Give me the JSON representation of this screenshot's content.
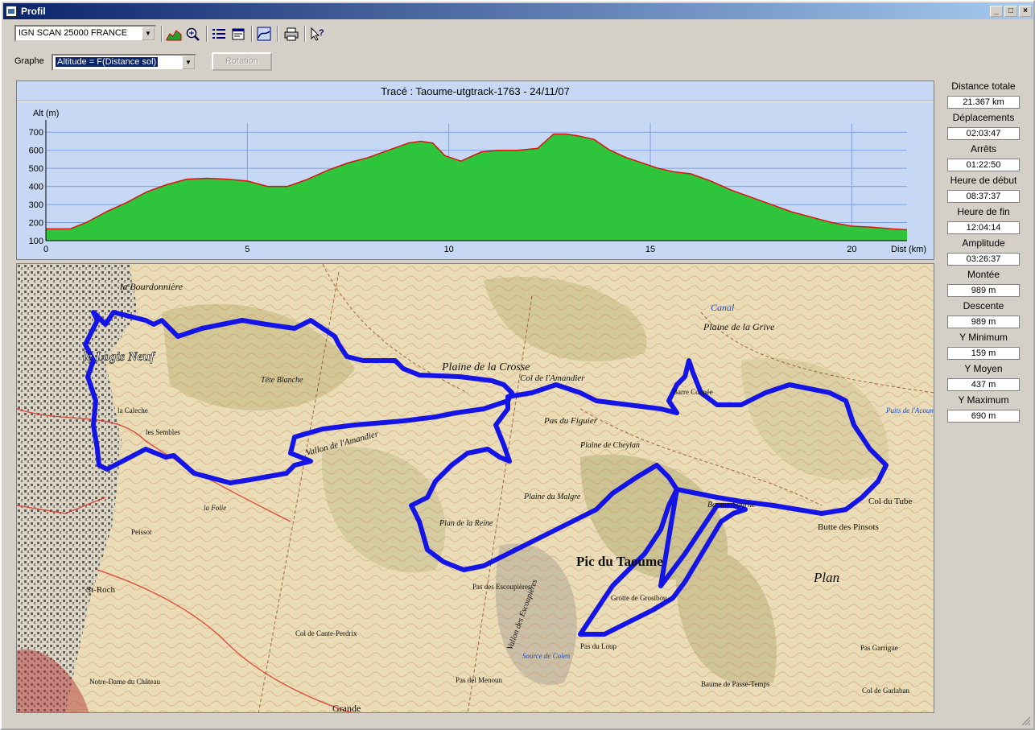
{
  "window": {
    "title": "Profil"
  },
  "titlebar_buttons": [
    "_",
    "□",
    "×"
  ],
  "toolbar": {
    "map_source": "IGN SCAN 25000 FRANCE",
    "icons": [
      "profile-icon",
      "zoom-icon",
      "list-icon",
      "properties-icon",
      "graph-icon",
      "print-icon",
      "help-pointer-icon"
    ]
  },
  "graph_row": {
    "label": "Graphe",
    "selected": "Altitude = F(Distance sol)",
    "rotation_button": "Rotation"
  },
  "chart_title": "Tracé : Taoume-utgtrack-1763 - 24/11/07",
  "chart_data": {
    "type": "area",
    "ylabel": "Alt (m)",
    "xlabel": "Dist (km)",
    "xlim": [
      0,
      21.37
    ],
    "ylim": [
      100,
      750
    ],
    "yticks": [
      100,
      200,
      300,
      400,
      500,
      600,
      700
    ],
    "xticks": [
      0,
      5,
      10,
      15,
      20
    ],
    "grid": true,
    "fill_color": "#2ec43c",
    "line_color": "#e01010",
    "background": "#c6d8f4",
    "x": [
      0,
      0.6,
      1,
      1.5,
      2,
      2.5,
      3,
      3.5,
      4,
      4.5,
      5,
      5.5,
      6,
      6.5,
      7,
      7.5,
      8,
      8.5,
      9,
      9.3,
      9.6,
      9.9,
      10.3,
      10.8,
      11.2,
      11.7,
      12.2,
      12.6,
      12.9,
      13.2,
      13.6,
      14,
      14.4,
      14.8,
      15.2,
      15.6,
      16,
      16.5,
      17,
      17.5,
      18,
      18.5,
      19,
      19.5,
      20,
      20.5,
      21,
      21.37
    ],
    "y": [
      165,
      165,
      200,
      260,
      310,
      370,
      410,
      440,
      445,
      440,
      430,
      400,
      400,
      440,
      490,
      530,
      560,
      600,
      640,
      650,
      640,
      570,
      540,
      590,
      600,
      600,
      610,
      690,
      690,
      680,
      660,
      600,
      560,
      530,
      500,
      480,
      470,
      430,
      380,
      340,
      300,
      260,
      230,
      200,
      180,
      175,
      165,
      160
    ]
  },
  "map": {
    "labels": [
      {
        "t": "la Bourdonnière"
      },
      {
        "t": "le Logis Neuf"
      },
      {
        "t": "Tête Blanche"
      },
      {
        "t": "Plaine de la Crosse"
      },
      {
        "t": "Col de l'Amandier"
      },
      {
        "t": "Pas du Figuier"
      },
      {
        "t": "Plaine de Cheylan"
      },
      {
        "t": "Vallon de l'Amandier"
      },
      {
        "t": "Plan de la Reine"
      },
      {
        "t": "Plaine du Malgre"
      },
      {
        "t": "Pic du Taoume"
      },
      {
        "t": "Baume-Sourne"
      },
      {
        "t": "Col du Tube"
      },
      {
        "t": "Butte des Pinsots"
      },
      {
        "t": "Plaine de la Grive"
      },
      {
        "t": "Canal"
      },
      {
        "t": "St-Roch"
      },
      {
        "t": "Col de Cante-Perdrix"
      },
      {
        "t": "Pas du Loup"
      },
      {
        "t": "Grotte de Grosibou"
      },
      {
        "t": "Plan"
      },
      {
        "t": "Col de Garlaban"
      },
      {
        "t": "Notre-Dame du Château"
      },
      {
        "t": "Grande"
      },
      {
        "t": "Pas des Escoupières"
      },
      {
        "t": "Vallon des Escoupières"
      },
      {
        "t": "la Caleche"
      },
      {
        "t": "les Sembles"
      },
      {
        "t": "la Folie"
      },
      {
        "t": "Peissot"
      },
      {
        "t": "Pas Garrigue"
      },
      {
        "t": "Baume de Passe-Temps"
      },
      {
        "t": "Barre Coupée"
      },
      {
        "t": "Puits de l'Acoumi"
      },
      {
        "t": "Source de Colen"
      },
      {
        "t": "Pas del Menoun"
      }
    ]
  },
  "stats": [
    {
      "label": "Distance totale",
      "value": "21.367 km"
    },
    {
      "label": "Déplacements",
      "value": "02:03:47"
    },
    {
      "label": "Arrêts",
      "value": "01:22:50"
    },
    {
      "label": "Heure de début",
      "value": "08:37:37"
    },
    {
      "label": "Heure de fin",
      "value": "12:04:14"
    },
    {
      "label": "Amplitude",
      "value": "03:26:37"
    },
    {
      "label": "Montée",
      "value": "989 m"
    },
    {
      "label": "Descente",
      "value": "989 m"
    },
    {
      "label": "Y Minimum",
      "value": "159 m"
    },
    {
      "label": "Y Moyen",
      "value": "437 m"
    },
    {
      "label": "Y Maximum",
      "value": "690 m"
    }
  ]
}
